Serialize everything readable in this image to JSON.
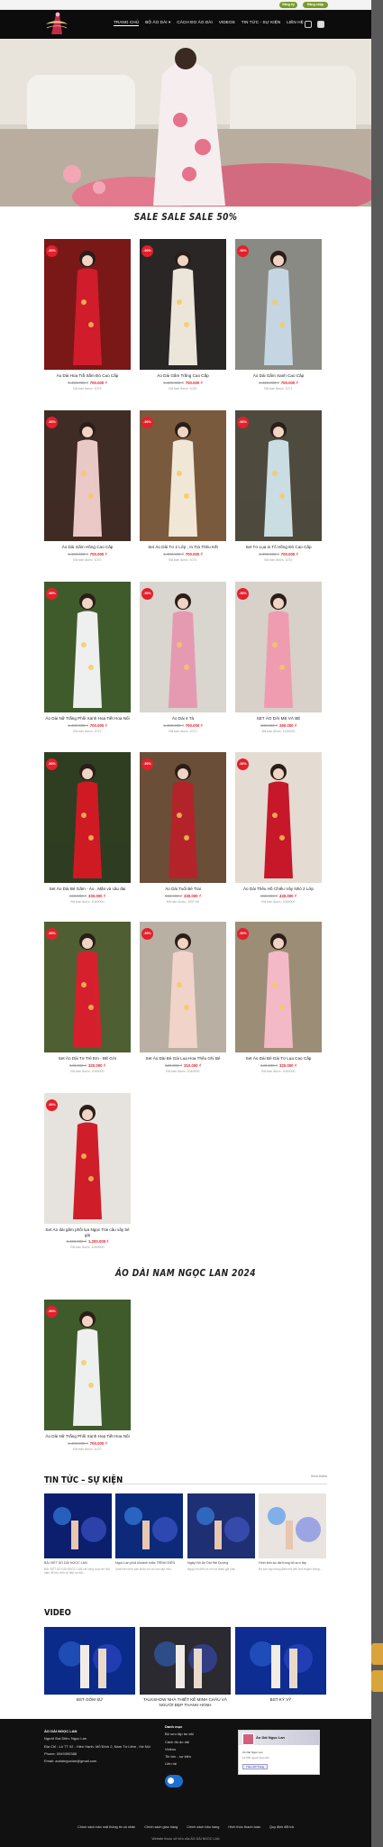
{
  "topbar": {
    "btn_a": "Đăng ký",
    "btn_b": "Đăng nhập"
  },
  "nav": {
    "items": [
      "TRANG CHỦ",
      "BỘ ÁO DÀI ▾",
      "CÁCH ĐO ÁO DÀI",
      "VIDEOS",
      "TIN TỨC - SỰ KIỆN",
      "LIÊN HỆ"
    ]
  },
  "sale_title": "SALE SALE SALE 50%",
  "products": [
    {
      "name": "Áo Dài Hoa Trắ Sắm Đỏ Cao Cấp",
      "old": "1.400.000 ₫",
      "new": "700.000 ₫",
      "sold": "Đã bán được: 1073",
      "badge": "-50%",
      "bg": "#7a1818",
      "dress": "#d11c2c"
    },
    {
      "name": "Áo Dài Gấm Trắng Cao Cấp",
      "old": "1.400.000 ₫",
      "new": "700.000 ₫",
      "sold": "Đã bán được: 1030",
      "badge": "-50%",
      "bg": "#2a2626",
      "dress": "#ece6da"
    },
    {
      "name": "Áo Dài Gấm Xanh Cao Cấp",
      "old": "1.400.000 ₫",
      "new": "700.000 ₫",
      "sold": "Đã bán được: 1071",
      "badge": "-50%",
      "bg": "#8a8a84",
      "dress": "#c5d6e2"
    },
    {
      "name": "Áo Dài Gấm Hồng Cao Cấp",
      "old": "1.400.000 ₫",
      "new": "700.000 ₫",
      "sold": "Đã bán được: 1072",
      "badge": "-50%",
      "bg": "#3f2c24",
      "dress": "#e9c9c6"
    },
    {
      "name": "Set Áo Dài Tơ 2 Lớp , In Trà Thêu Kết",
      "old": "1.400.000 ₫",
      "new": "700.000 ₫",
      "sold": "Đã bán được: 1071",
      "badge": "-50%",
      "bg": "#7a5a3c",
      "dress": "#f1e7d6"
    },
    {
      "name": "Set Tơ Lụa in Tổ Hồng Đỏ Cao Cấp",
      "old": "1.400.000 ₫",
      "new": "700.000 ₫",
      "sold": "Đã bán được: 1072",
      "badge": "-50%",
      "bg": "#4e4a3e",
      "dress": "#c9dde3"
    },
    {
      "name": "Áo Dài Nữ Trắng Phối Xanh Hoạ Tiết Hoa Nổi",
      "old": "1.400.000 ₫",
      "new": "700.000 ₫",
      "sold": "Đã bán được: 1072",
      "badge": "-50%",
      "bg": "#3f5b2c",
      "dress": "#eef0ef"
    },
    {
      "name": "Áo Dài 4 Tà",
      "old": "1.400.000 ₫",
      "new": "700.000 ₫",
      "sold": "Đã bán được: 1072",
      "badge": "-50%",
      "bg": "#d9d5cf",
      "dress": "#e59ab2"
    },
    {
      "name": "SET ÁO DÀI MẸ VÀ BÉ",
      "old": "580.000 ₫",
      "new": "290.000 ₫",
      "sold": "Đã bán được: 1139000",
      "badge": "-50%",
      "bg": "#d7d1c9",
      "dress": "#ef9cb0"
    },
    {
      "name": "Set Áo Dài Bé Gấm - Áo , Mấn và câu đai",
      "old": "660.000 ₫",
      "new": "330.000 ₫",
      "sold": "Đã bán được: 1049000",
      "badge": "-50%",
      "bg": "#2f3d21",
      "dress": "#cf1a24"
    },
    {
      "name": "Áo Dài Tuổi Bé Trai",
      "old": "660.000 ₫",
      "new": "330.000 ₫",
      "sold": "Đã bán được: 1097 bộ",
      "badge": "-50%",
      "bg": "#6a4e38",
      "dress": "#b3242a"
    },
    {
      "name": "Áo Dài Thêu Hồ Chiếu Vây Nhỏ 2 Lớp",
      "old": "860.000 ₫",
      "new": "430.000 ₫",
      "sold": "Đã bán được: 1049000",
      "badge": "-50%",
      "bg": "#e4dcd2",
      "dress": "#c6182a"
    },
    {
      "name": "Set Áo Dài Tơ Trẻ Em - BÉ GÁI",
      "old": "640.000 ₫",
      "new": "320.000 ₫",
      "sold": "Đã bán được: 1049000",
      "badge": "-50%",
      "bg": "#4f5f33",
      "dress": "#d6202c"
    },
    {
      "name": "Set Áo Dài Bé Gái Luạ Hoa Thêu Ghi Bé",
      "old": "620.000 ₫",
      "new": "310.000 ₫",
      "sold": "Đã bán được: 1049000",
      "badge": "-50%",
      "bg": "#b9b0a4",
      "dress": "#f1d3ca"
    },
    {
      "name": "Set Áo Dài Bé Gái Tơ Lụa Cao Cấp",
      "old": "640.000 ₫",
      "new": "320.000 ₫",
      "sold": "Đã bán được: 1049000",
      "badge": "-50%",
      "bg": "#9b8d76",
      "dress": "#f4b9c6"
    },
    {
      "name": "Set Áo dài gấm phối lụa Ngọc Trai câu vây bé gái",
      "old": "2.400.000 ₫",
      "new": "1.200.000 ₫",
      "sold": "Đã bán được: 1049000",
      "badge": "-50%",
      "bg": "#e6e3de",
      "dress": "#cf1e2a"
    }
  ],
  "men_title": "ÁO DÀI NAM NGỌC LAN 2024",
  "men_product": {
    "name": "Áo Dài Nữ Trắng Phối Xanh Hoạ Tiết Hoa Nổi",
    "old": "1.400.000 ₫",
    "new": "700.000 ₫",
    "sold": "Đã bán được: 1072",
    "badge": "-50%",
    "bg": "#3f5b2c",
    "dress": "#eef0ef"
  },
  "news_section": {
    "title": "TIN TỨC – SỰ KIỆN",
    "more": "Xem thêm"
  },
  "news": [
    {
      "title": "BÀI VIẾT ÁO DÀI NGỌC LAN",
      "excerpt": "BÀI VIẾT ÁO DÀI NGỌC LAN chỉ vòng cuộc thi mỗi năm để tôn vinh vẻ đẹp áo dài...",
      "bg": "#0b1f6e"
    },
    {
      "title": "Ngọc Lan phối khoảnh khắc TRÌNH DIỄN",
      "excerpt": "Xuất hiện trên sân khấu với bộ sưu tập mới...",
      "bg": "#0d2a7a"
    },
    {
      "title": "Ngày Hội Áo Dài Hải Dương",
      "excerpt": "Ngày hội diễn ra với sự tham gia của...",
      "bg": "#1e2f73"
    },
    {
      "title": "Hình ảnh áo dài trong bộ sưu tập",
      "excerpt": "Bộ sưu tập mang đậm nét văn hoá truyền thống...",
      "bg": "#e9e4df"
    }
  ],
  "video_section": {
    "title": "VIDEO"
  },
  "videos": [
    {
      "title": "BST GỐM SỨ",
      "bg": "#0a2b8a"
    },
    {
      "title": "TALKSHOW NHÀ THIẾT KẾ MINH CHÂU VÀ NGƯỜI ĐẸP THANH HÀNH",
      "bg": "#2a2a30"
    },
    {
      "title": "BST KỲ VỸ",
      "bg": "#0d2d92"
    }
  ],
  "footer": {
    "col1": [
      "ÁO DÀI NGỌC LAN",
      "Người Đại Diện: Ngọc Lan",
      "Địa Chỉ : Lô TT 02 - Hiền Hạnh, Mỗ Đình 2, Nam Từ Liêm , Hà Nội",
      "Phone: 0949390388",
      "Email: aodaingoclan@gmail.com"
    ],
    "col2": [
      "Danh mục",
      "Bộ sưu tập áo dài",
      "Cách đo áo dài",
      "Videos",
      "Tin tức - sự kiện",
      "Liên hệ"
    ],
    "fb_name": "Áo Dài Ngọc Lan",
    "fb_line1": "Áo Dài Ngọc Lan",
    "fb_line2": "12.563 người theo dõi",
    "fb_btn": "Theo dõi Trang",
    "links": [
      "Chính sách bảo mật thông tin cá nhân",
      "Chính sách giao hàng",
      "Chính sách bảo hàng",
      "Hình thức thanh toán",
      "Quy định đổi trả"
    ],
    "copyright": "Website thuộc sở hữu của ÁO DÀI NGỌC LAN"
  }
}
